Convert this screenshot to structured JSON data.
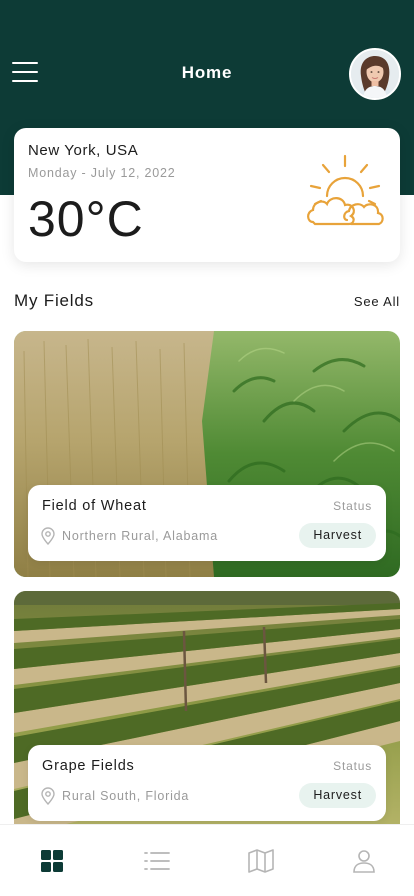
{
  "header": {
    "title": "Home",
    "menu_icon": "hamburger-menu-icon",
    "avatar_icon": "user-avatar"
  },
  "weather": {
    "city": "New York, USA",
    "date": "Monday - July 12, 2022",
    "temperature": "30°C",
    "icon": "sun-cloud-icon",
    "icon_color": "#e8a33a"
  },
  "fields_section": {
    "title": "My Fields",
    "see_all": "See All",
    "items": [
      {
        "name": "Field of Wheat",
        "status_label": "Status",
        "location": "Northern Rural, Alabama",
        "status": "Harvest"
      },
      {
        "name": "Grape Fields",
        "status_label": "Status",
        "location": "Rural South, Florida",
        "status": "Harvest"
      }
    ]
  },
  "bottom_nav": {
    "items": [
      {
        "name": "dashboard-grid-icon",
        "active": true
      },
      {
        "name": "list-icon",
        "active": false
      },
      {
        "name": "map-icon",
        "active": false
      },
      {
        "name": "profile-icon",
        "active": false
      }
    ]
  },
  "colors": {
    "header_bg": "#0d3b36",
    "accent": "#0d3b36",
    "badge_bg": "#e8f3ef",
    "muted_text": "#9a9a9a",
    "inactive_icon": "#b5b5b5"
  }
}
